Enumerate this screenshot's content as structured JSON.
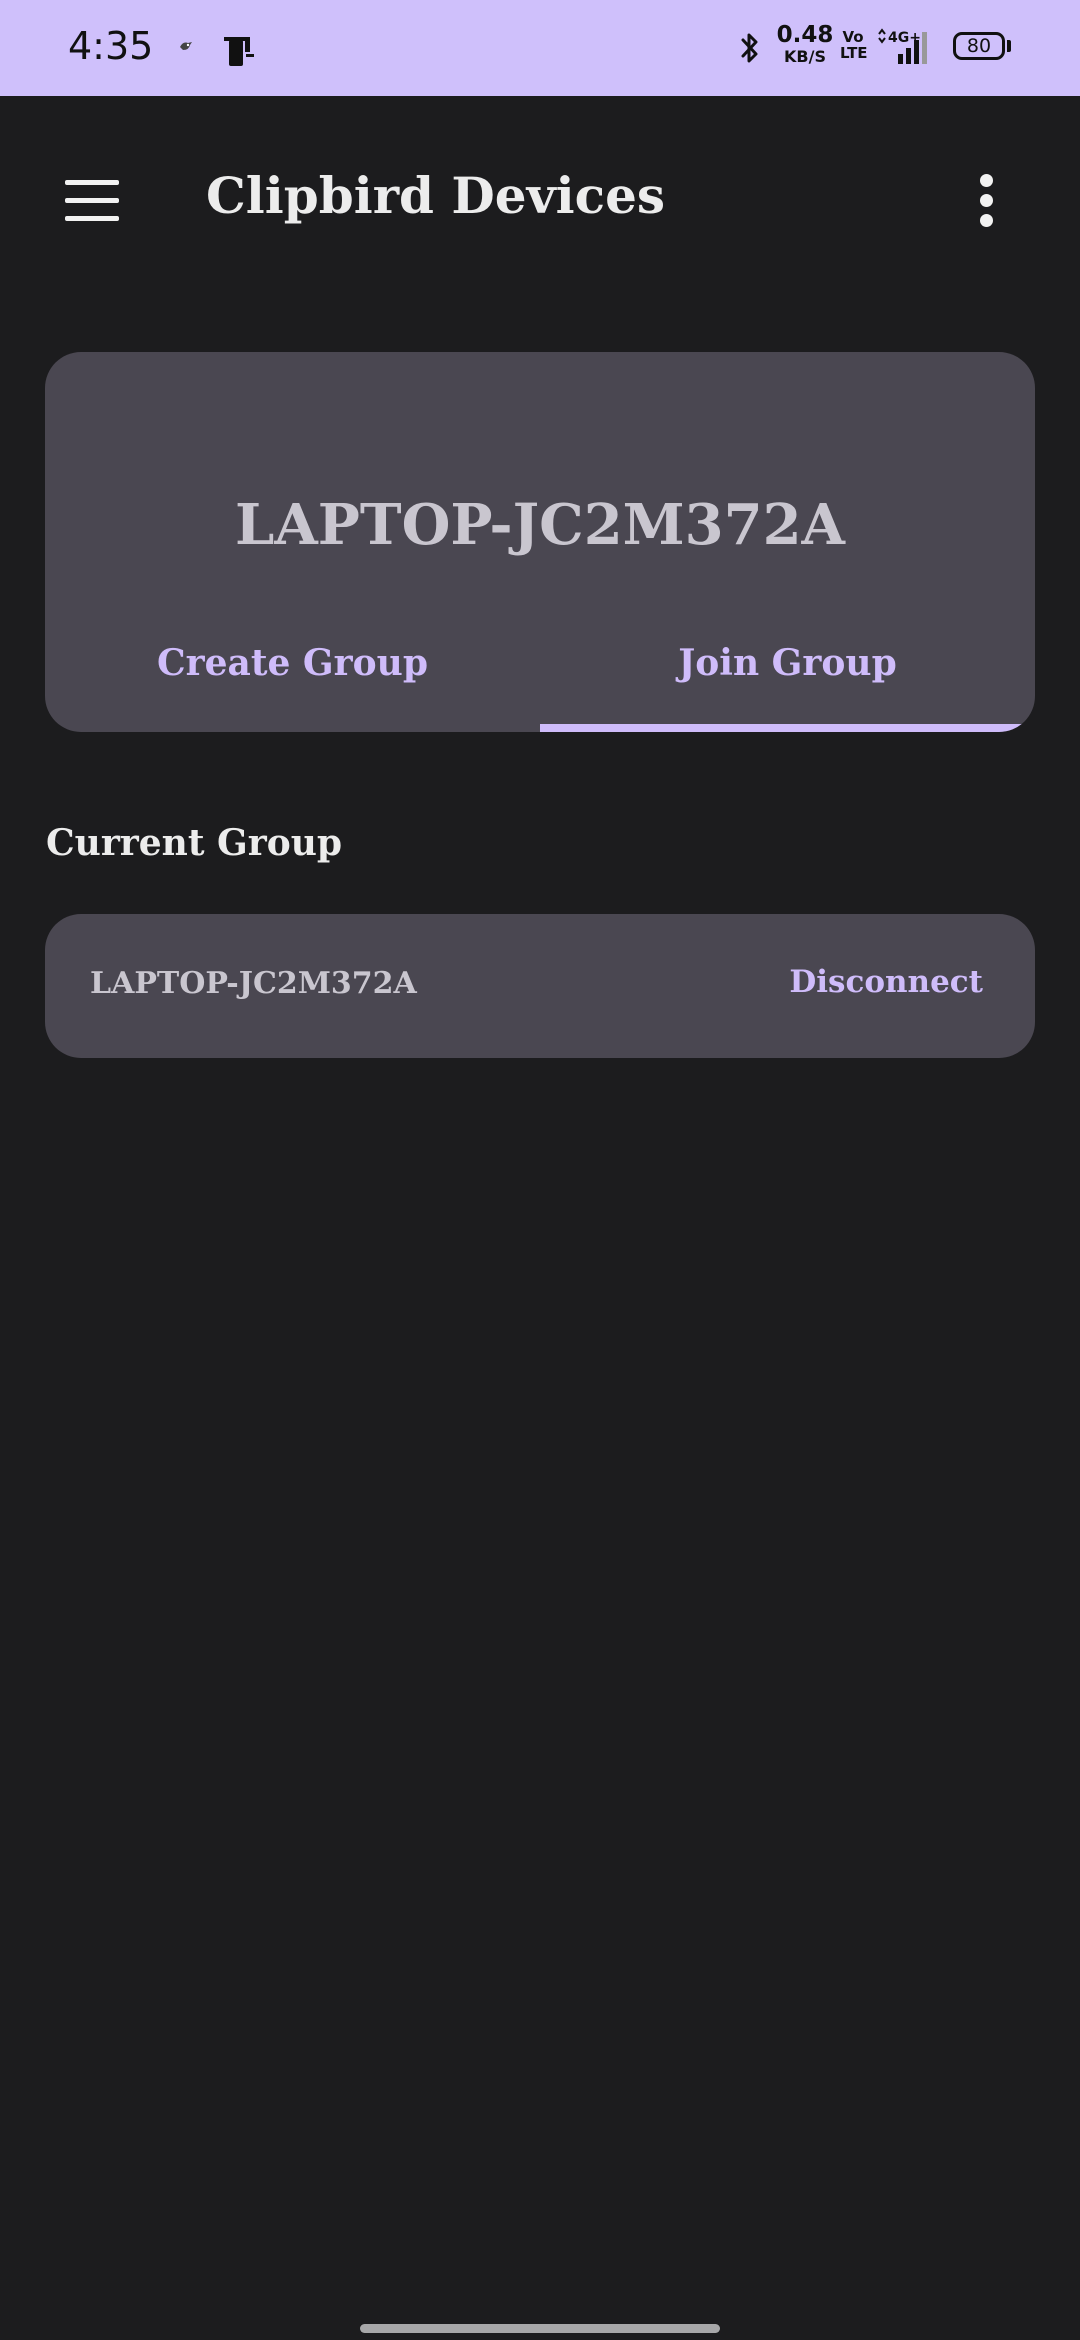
{
  "status_bar": {
    "time": "4:35",
    "net_speed_value": "0.48",
    "net_speed_unit": "KB/S",
    "volte_line1": "Vo",
    "volte_line2": "LTE",
    "network": "4G+",
    "battery": "80",
    "icons": [
      "notification-bird-icon",
      "phone-transfer-icon",
      "bluetooth-icon",
      "signal-icon",
      "battery-icon"
    ]
  },
  "app_bar": {
    "title": "Clipbird Devices",
    "menu_icon": "hamburger-menu-icon",
    "overflow_icon": "more-vertical-icon"
  },
  "device_card": {
    "device_name": "LAPTOP-JC2M372A",
    "tabs": [
      {
        "label": "Create Group",
        "selected": false
      },
      {
        "label": "Join Group",
        "selected": true
      }
    ]
  },
  "current_group": {
    "section_title": "Current Group",
    "name": "LAPTOP-JC2M372A",
    "action_label": "Disconnect"
  },
  "colors": {
    "status_bar_bg": "#cfc0fb",
    "background": "#1c1c1e",
    "card_bg": "#4a4751",
    "accent": "#cfbcfa",
    "title_text": "#ececec",
    "card_text": "#c9c6cf"
  }
}
